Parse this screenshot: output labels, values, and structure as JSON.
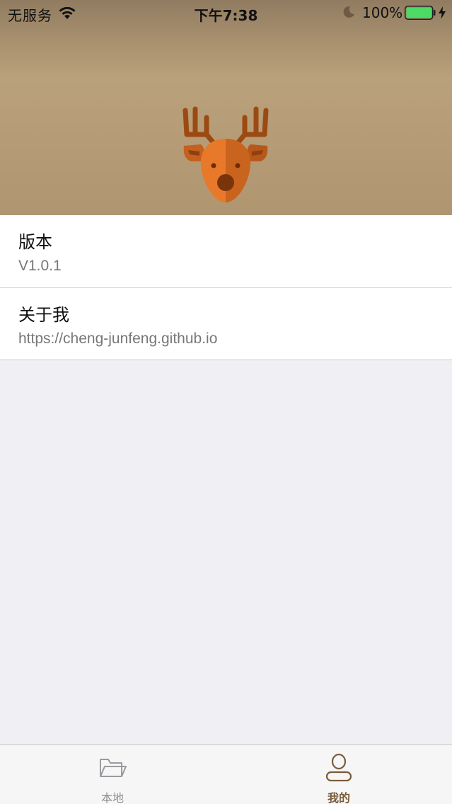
{
  "status_bar": {
    "carrier": "无服务",
    "time": "下午7:38",
    "battery_percent": "100%",
    "battery_level": 1.0,
    "icons": [
      "wifi-icon",
      "moon-icon",
      "battery-icon",
      "charging-bolt-icon"
    ]
  },
  "header": {
    "avatar_icon": "deer-icon"
  },
  "list": {
    "items": [
      {
        "title": "版本",
        "subtitle": "V1.0.1"
      },
      {
        "title": "关于我",
        "subtitle": "https://cheng-junfeng.github.io"
      }
    ]
  },
  "tabbar": {
    "tabs": [
      {
        "label": "本地",
        "icon": "folder-icon",
        "selected": false
      },
      {
        "label": "我的",
        "icon": "person-icon",
        "selected": true
      }
    ],
    "selected_color": "#7a5a3a",
    "unselected_color": "#8e8e93"
  },
  "colors": {
    "header_top": "#917c61",
    "header_bottom": "#b09670",
    "background": "#efeff4",
    "battery_fill": "#4cd964",
    "deer_orange": "#e8792a",
    "deer_antler": "#9c4a12"
  }
}
